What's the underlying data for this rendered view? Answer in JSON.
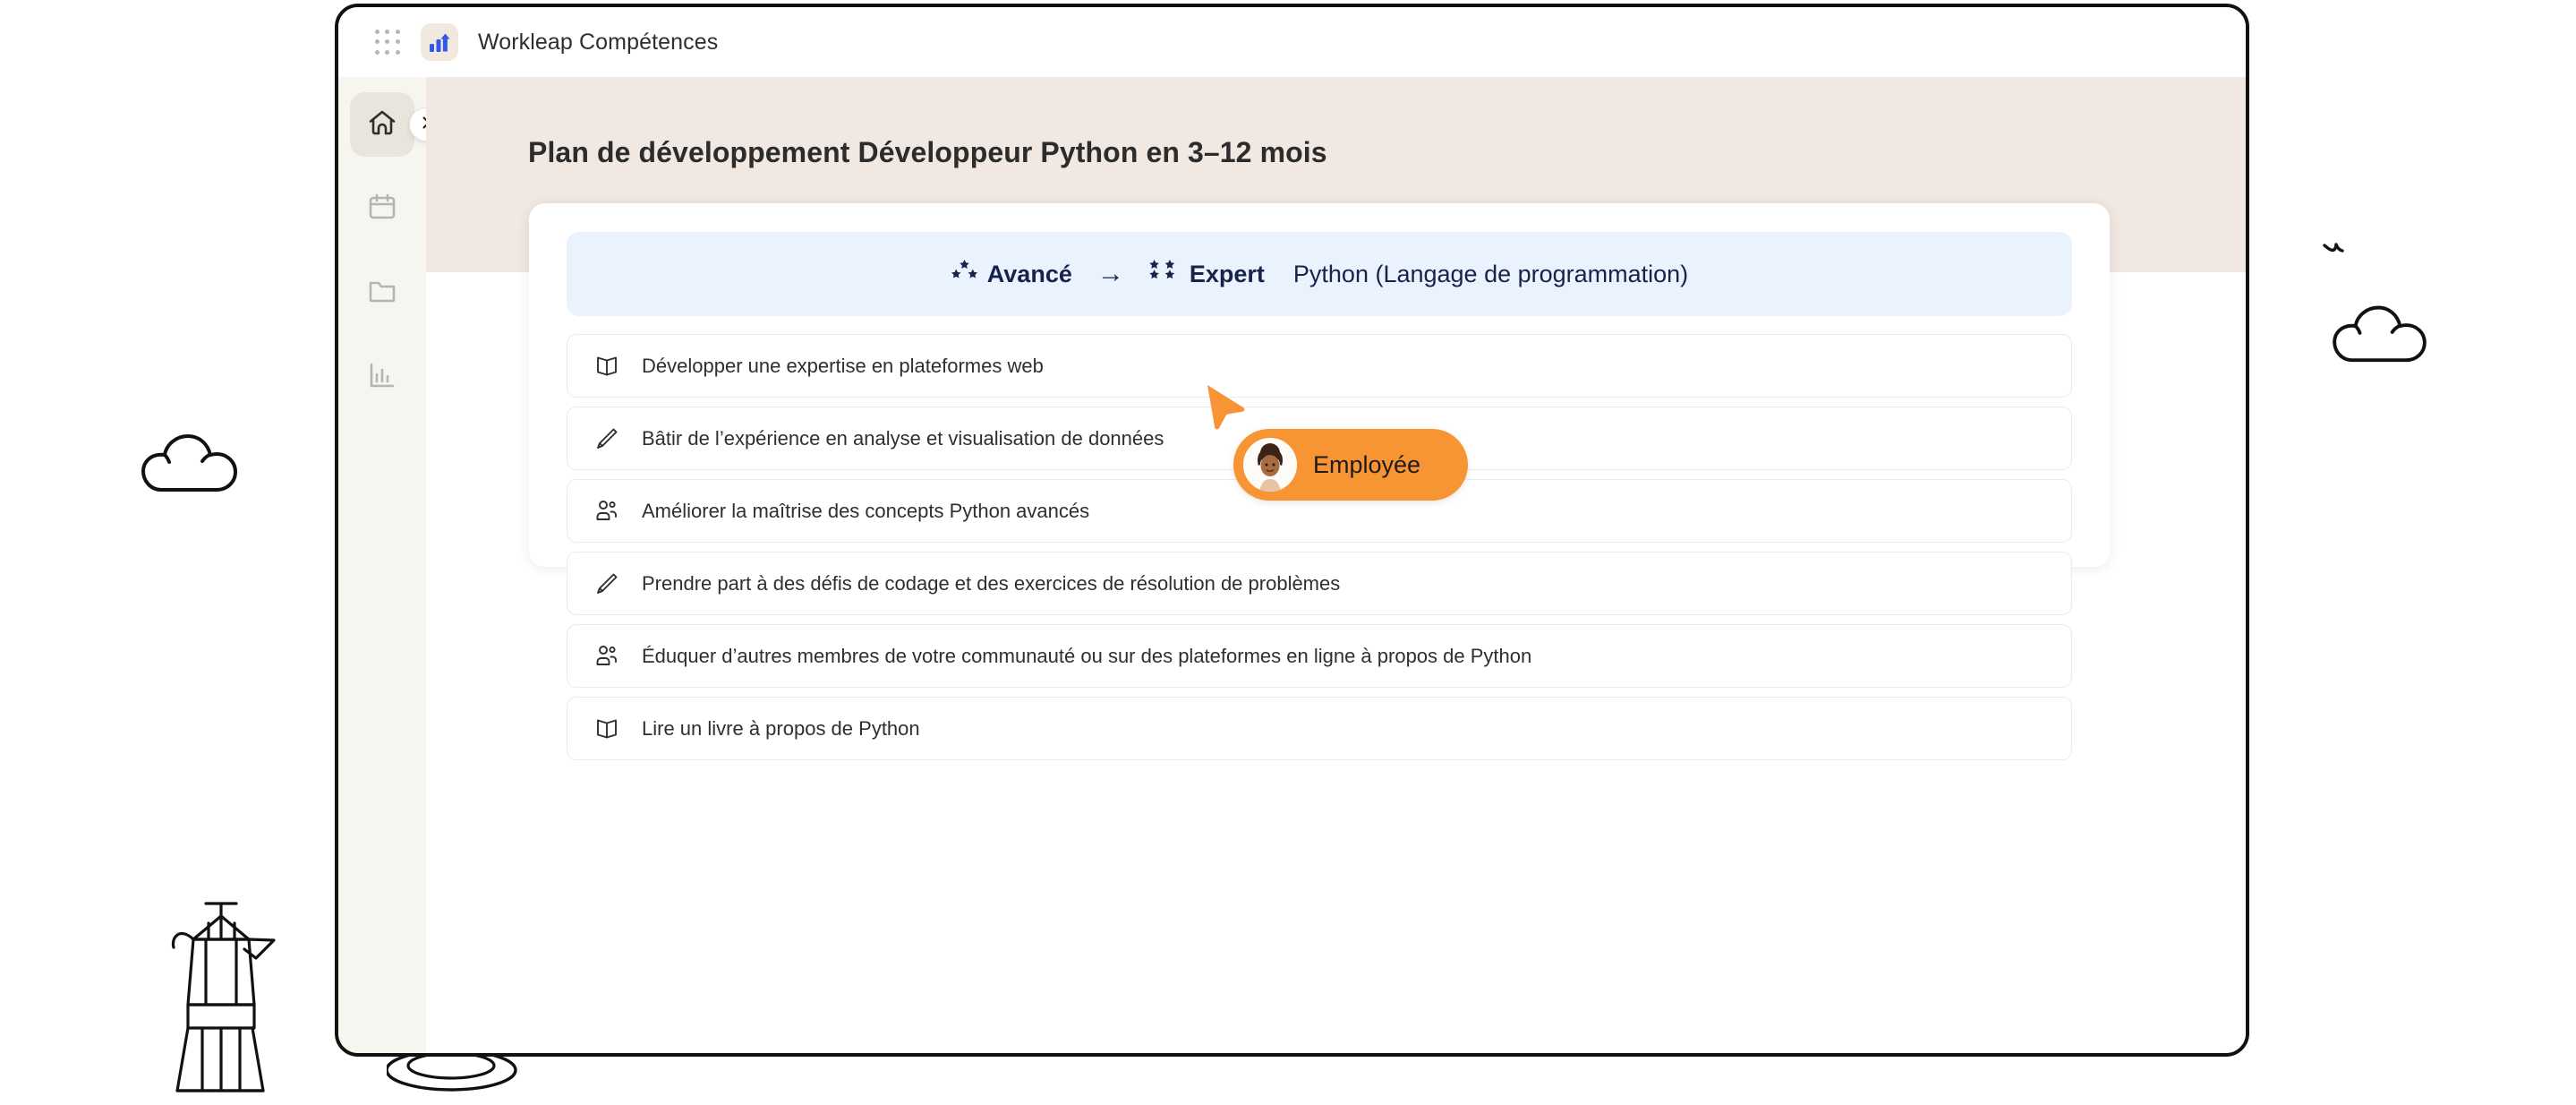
{
  "window": {
    "topbar": {
      "grid_icon": "apps-grid-icon",
      "app_icon": "bar-chart-logo-icon",
      "app_title": "Workleap Compétences"
    },
    "rail": {
      "items": [
        {
          "icon": "home-icon",
          "active": true,
          "name": "home"
        },
        {
          "icon": "calendar-icon",
          "active": false,
          "name": "calendar"
        },
        {
          "icon": "folder-icon",
          "active": false,
          "name": "folder"
        },
        {
          "icon": "chart-icon",
          "active": false,
          "name": "reports"
        }
      ],
      "expand_icon": "chevron-right-icon"
    },
    "page": {
      "title": "Plan de développement Développeur Python en 3–12 mois"
    },
    "skill_banner": {
      "current_level": {
        "label": "Avancé",
        "stars": 3,
        "icon": "three-stars-icon"
      },
      "arrow": "→",
      "target_level": {
        "label": "Expert",
        "stars": 4,
        "icon": "four-stars-icon"
      },
      "skill_name": "Python (Langage de programmation)"
    },
    "steps": [
      {
        "icon": "book-icon",
        "text": "Développer une expertise en plateformes web"
      },
      {
        "icon": "pencil-icon",
        "text": "Bâtir de l’expérience en analyse et visualisation de données"
      },
      {
        "icon": "people-icon",
        "text": "Améliorer la maîtrise des concepts Python avancés"
      },
      {
        "icon": "pencil-icon",
        "text": "Prendre part à des défis de codage et des exercices de résolution de problèmes"
      },
      {
        "icon": "people-icon",
        "text": "Éduquer d’autres membres de votre communauté ou sur des plateformes en ligne à propos de Python"
      },
      {
        "icon": "book-icon",
        "text": "Lire un livre à propos de Python"
      }
    ]
  },
  "annotation": {
    "cursor_icon": "orange-pointer-cursor-icon",
    "persona_label": "Employée",
    "avatar_icon": "employee-avatar"
  },
  "decor": {
    "cloud_left": "cloud-icon",
    "cloud_right": "cloud-icon",
    "bird": "bird-icon",
    "moka_pot": "moka-pot-icon",
    "coffee_cup": "coffee-cup-icon"
  },
  "colors": {
    "accent_orange": "#f79434",
    "banner_blue": "#eaf3fd",
    "banner_text": "#16244c",
    "beige_band": "#f0e8e1",
    "rail_bg": "#f7f5f0",
    "logo_blue": "#3358e8",
    "steam_blue": "#1d3df0"
  }
}
